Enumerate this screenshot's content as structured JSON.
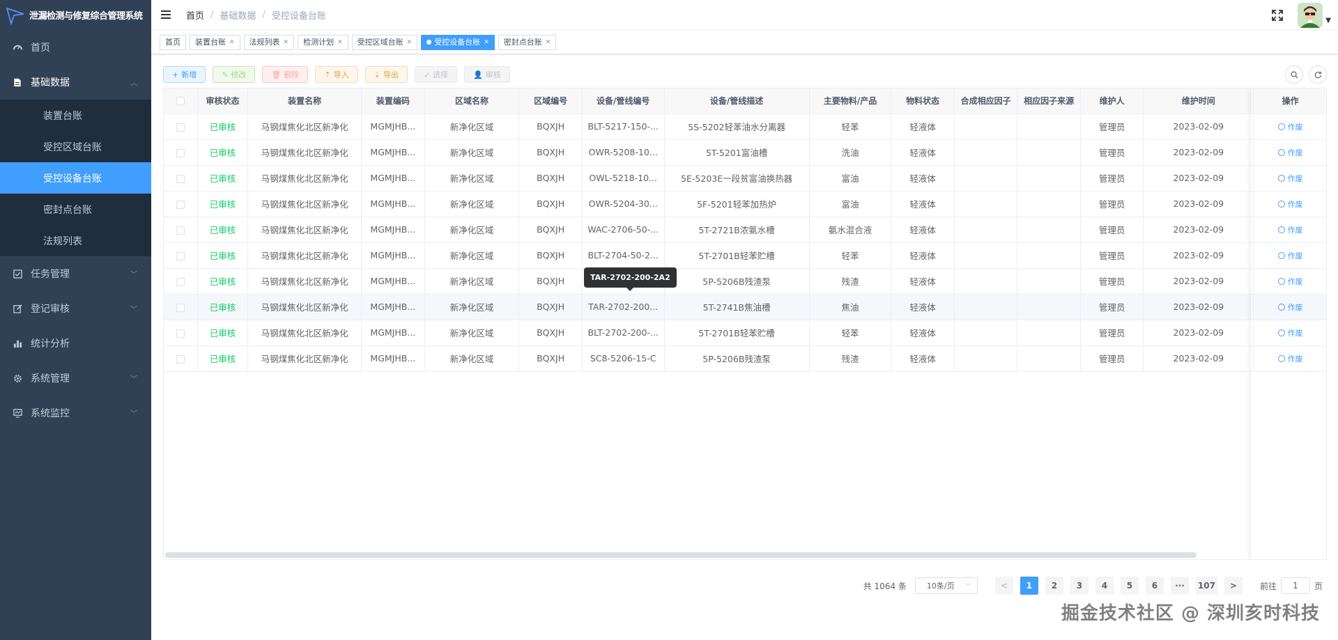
{
  "app": {
    "title": "泄漏检测与修复综合管理系统"
  },
  "sidebar": {
    "items": [
      {
        "label": "首页",
        "icon": "dashboard-icon"
      },
      {
        "label": "基础数据",
        "icon": "document-icon"
      },
      {
        "label": "任务管理",
        "icon": "checkbox-icon"
      },
      {
        "label": "登记审核",
        "icon": "edit-icon"
      },
      {
        "label": "统计分析",
        "icon": "bar-chart-icon"
      },
      {
        "label": "系统管理",
        "icon": "gear-icon"
      },
      {
        "label": "系统监控",
        "icon": "monitor-icon"
      }
    ],
    "sub_items": [
      "装置台账",
      "受控区域台账",
      "受控设备台账",
      "密封点台账",
      "法规列表"
    ]
  },
  "breadcrumb": [
    "首页",
    "基础数据",
    "受控设备台账"
  ],
  "tags": [
    "首页",
    "装置台账",
    "法规列表",
    "检测计划",
    "受控区域台账",
    "受控设备台账",
    "密封点台账"
  ],
  "toolbar": {
    "add": "新增",
    "edit": "修改",
    "delete": "删除",
    "import": "导入",
    "export": "导出",
    "select": "选择",
    "audit": "审核"
  },
  "table": {
    "headers": [
      "审核状态",
      "装置名称",
      "装置编码",
      "区域名称",
      "区域编号",
      "设备/管线编号",
      "设备/管线描述",
      "主要物料/产品",
      "物料状态",
      "合成相应因子",
      "相应因子来源",
      "维护人",
      "维护时间",
      "操作"
    ],
    "rows": [
      [
        "已审核",
        "马钢煤焦化北区新净化",
        "MGMJHB...",
        "新净化区域",
        "BQXJH",
        "BLT-5217-150-...",
        "5S-5202轻苯油水分离器",
        "轻苯",
        "轻液体",
        "",
        "",
        "管理员",
        "2023-02-09",
        "作废"
      ],
      [
        "已审核",
        "马钢煤焦化北区新净化",
        "MGMJHB...",
        "新净化区域",
        "BQXJH",
        "OWR-5208-10...",
        "5T-5201富油槽",
        "洗油",
        "轻液体",
        "",
        "",
        "管理员",
        "2023-02-09",
        "作废"
      ],
      [
        "已审核",
        "马钢煤焦化北区新净化",
        "MGMJHB...",
        "新净化区域",
        "BQXJH",
        "OWL-5218-10...",
        "5E-5203E一段贫富油换热器",
        "富油",
        "轻液体",
        "",
        "",
        "管理员",
        "2023-02-09",
        "作废"
      ],
      [
        "已审核",
        "马钢煤焦化北区新净化",
        "MGMJHB...",
        "新净化区域",
        "BQXJH",
        "OWR-5204-30...",
        "5F-5201轻苯加热炉",
        "富油",
        "轻液体",
        "",
        "",
        "管理员",
        "2023-02-09",
        "作废"
      ],
      [
        "已审核",
        "马钢煤焦化北区新净化",
        "MGMJHB...",
        "新净化区域",
        "BQXJH",
        "WAC-2706-50-...",
        "5T-2721B浓氨水槽",
        "氨水混合液",
        "轻液体",
        "",
        "",
        "管理员",
        "2023-02-09",
        "作废"
      ],
      [
        "已审核",
        "马钢煤焦化北区新净化",
        "MGMJHB...",
        "新净化区域",
        "BQXJH",
        "BLT-2704-50-2...",
        "5T-2701B轻苯贮槽",
        "轻苯",
        "轻液体",
        "",
        "",
        "管理员",
        "2023-02-09",
        "作废"
      ],
      [
        "已审核",
        "马钢煤焦化北区新净化",
        "MGMJHB...",
        "新净化区域",
        "BQXJH",
        "",
        "5P-5206B残渣泵",
        "残渣",
        "轻液体",
        "",
        "",
        "管理员",
        "2023-02-09",
        "作废"
      ],
      [
        "已审核",
        "马钢煤焦化北区新净化",
        "MGMJHB...",
        "新净化区域",
        "BQXJH",
        "TAR-2702-200...",
        "5T-2741B焦油槽",
        "焦油",
        "轻液体",
        "",
        "",
        "管理员",
        "2023-02-09",
        "作废"
      ],
      [
        "已审核",
        "马钢煤焦化北区新净化",
        "MGMJHB...",
        "新净化区域",
        "BQXJH",
        "BLT-2702-200-...",
        "5T-2701B轻苯贮槽",
        "轻苯",
        "轻液体",
        "",
        "",
        "管理员",
        "2023-02-09",
        "作废"
      ],
      [
        "已审核",
        "马钢煤焦化北区新净化",
        "MGMJHB...",
        "新净化区域",
        "BQXJH",
        "SC8-5206-15-C",
        "5P-5206B残渣泵",
        "残渣",
        "轻液体",
        "",
        "",
        "管理员",
        "2023-02-09",
        "作废"
      ]
    ]
  },
  "tooltip": "TAR-2702-200-2A2",
  "pagination": {
    "total": "共 1064 条",
    "page_size": "10条/页",
    "prev": "<",
    "next": ">",
    "pages": [
      "1",
      "2",
      "3",
      "4",
      "5",
      "6",
      "···",
      "107"
    ],
    "goto_label": "前往",
    "goto_value": "1",
    "goto_suffix": "页"
  },
  "watermark": "掘金技术社区 @ 深圳亥时科技",
  "colors": {
    "sidebar_bg": "#304156",
    "submenu_bg": "#1f2d3d",
    "primary": "#409eff",
    "status_green": "#13ce66"
  }
}
